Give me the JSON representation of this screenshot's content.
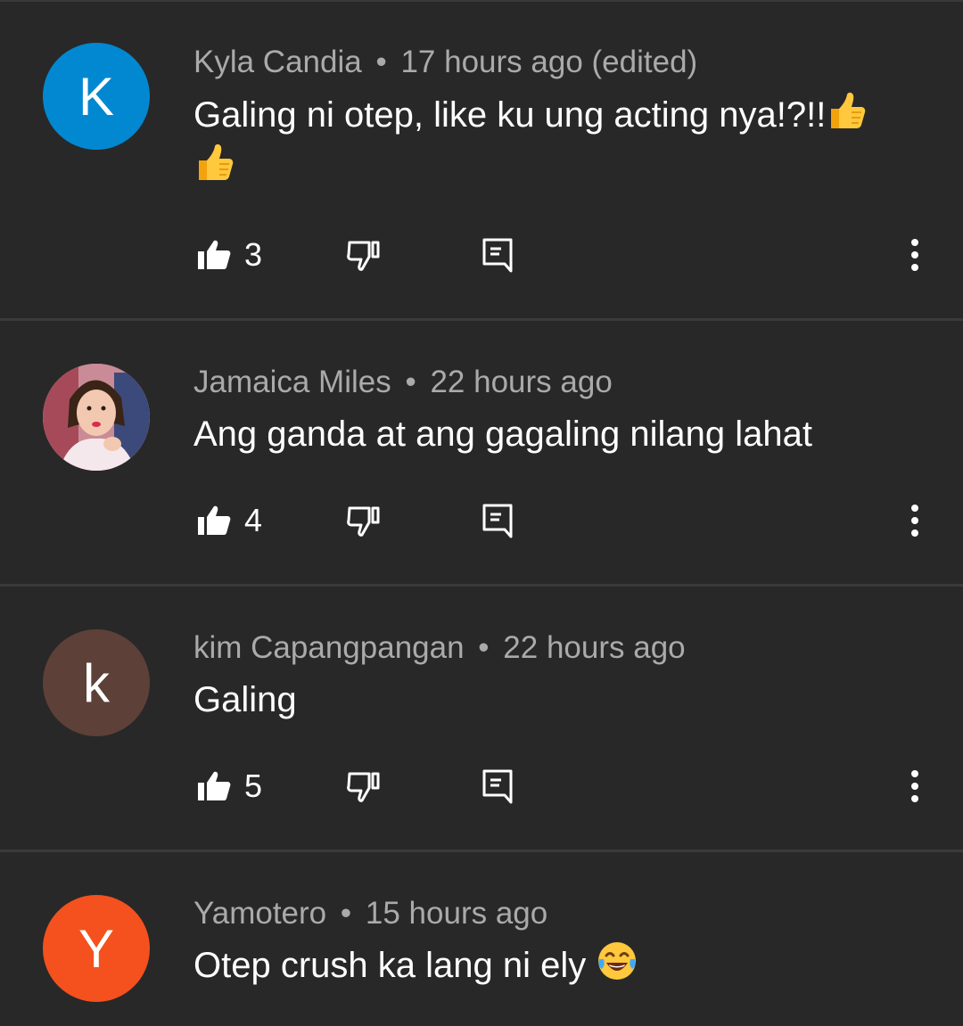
{
  "comments": [
    {
      "avatar_letter": "K",
      "avatar_color": "#0288d1",
      "author": "Kyla Candia",
      "time": "17 hours ago (edited)",
      "text": "Galing ni otep, like ku ung acting nya!?!!",
      "likes": "3"
    },
    {
      "avatar_letter": "",
      "avatar_color": "#d9a6a8",
      "author": "Jamaica Miles",
      "time": "22 hours ago",
      "text": "Ang ganda at ang gagaling nilang lahat",
      "likes": "4"
    },
    {
      "avatar_letter": "k",
      "avatar_color": "#5d4037",
      "author": "kim Capangpangan",
      "time": "22 hours ago",
      "text": "Galing",
      "likes": "5"
    },
    {
      "avatar_letter": "Y",
      "avatar_color": "#f4511e",
      "author": "Yamotero",
      "time": "15 hours ago",
      "text": "Otep crush ka lang ni ely",
      "likes": ""
    }
  ],
  "separator": "•",
  "icons": {
    "like": "thumbs-up-icon",
    "dislike": "thumbs-down-icon",
    "reply": "reply-icon",
    "more": "more-vert-icon",
    "emoji_thumbs": "thumbs-up-emoji",
    "emoji_laugh": "tears-of-joy-emoji"
  },
  "colors": {
    "background": "#282828",
    "divider": "#3a3a3a",
    "meta_text": "#aaaaaa",
    "body_text": "#ffffff"
  }
}
